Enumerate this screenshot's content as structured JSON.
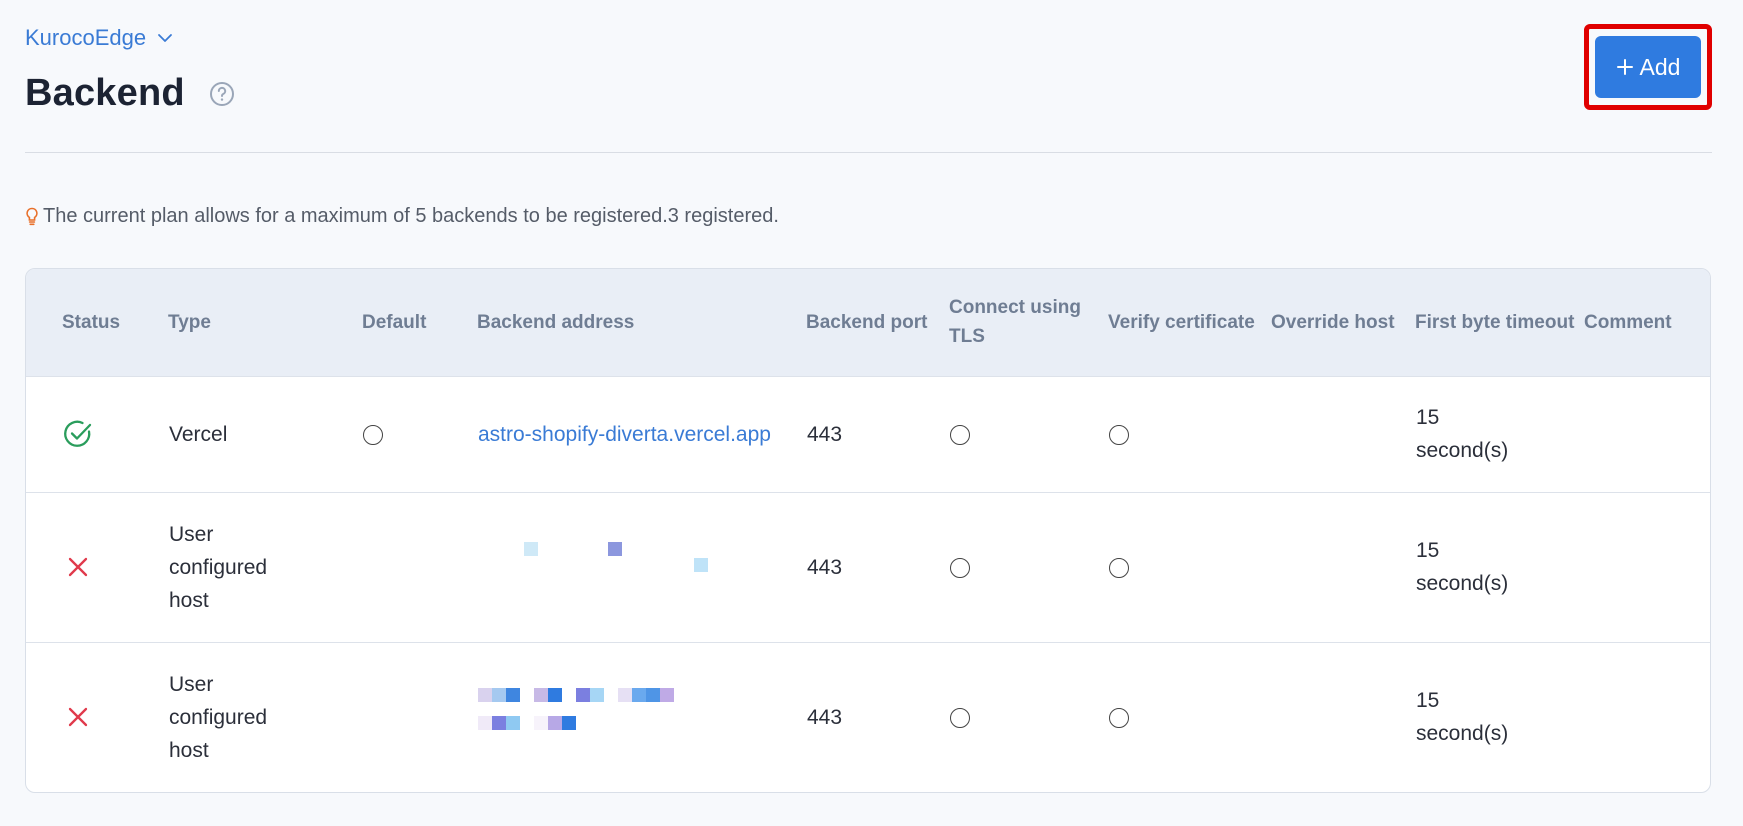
{
  "header": {
    "breadcrumb": "KurocoEdge",
    "title": "Backend",
    "add_label": "Add"
  },
  "notice": "The current plan allows for a maximum of 5 backends to be registered.3 registered.",
  "table": {
    "columns": [
      "Status",
      "Type",
      "Default",
      "Backend address",
      "Backend port",
      "Connect using TLS",
      "Verify certificate",
      "Override host",
      "First byte timeout",
      "Comment"
    ],
    "rows": [
      {
        "status": "ok",
        "type": "Vercel",
        "address": "astro-shopify-diverta.vercel.app",
        "port": "443",
        "timeout": "15 second(s)",
        "comment": ""
      },
      {
        "status": "error",
        "type": "User configured host",
        "address": "",
        "port": "443",
        "timeout": "15 second(s)",
        "comment": ""
      },
      {
        "status": "error",
        "type": "User configured host",
        "address": "",
        "port": "443",
        "timeout": "15 second(s)",
        "comment": ""
      }
    ]
  },
  "colors": {
    "accent": "#2f7be0",
    "link": "#3a7bd5",
    "ok": "#2a9d5c",
    "error": "#e0394b",
    "highlight": "#e00000"
  },
  "icons": {
    "breadcrumb": "chevron-down-icon",
    "help": "question-circle-icon",
    "add": "plus-icon",
    "notice": "lightbulb-icon",
    "ok": "check-circle-icon",
    "error": "x-mark-icon"
  }
}
